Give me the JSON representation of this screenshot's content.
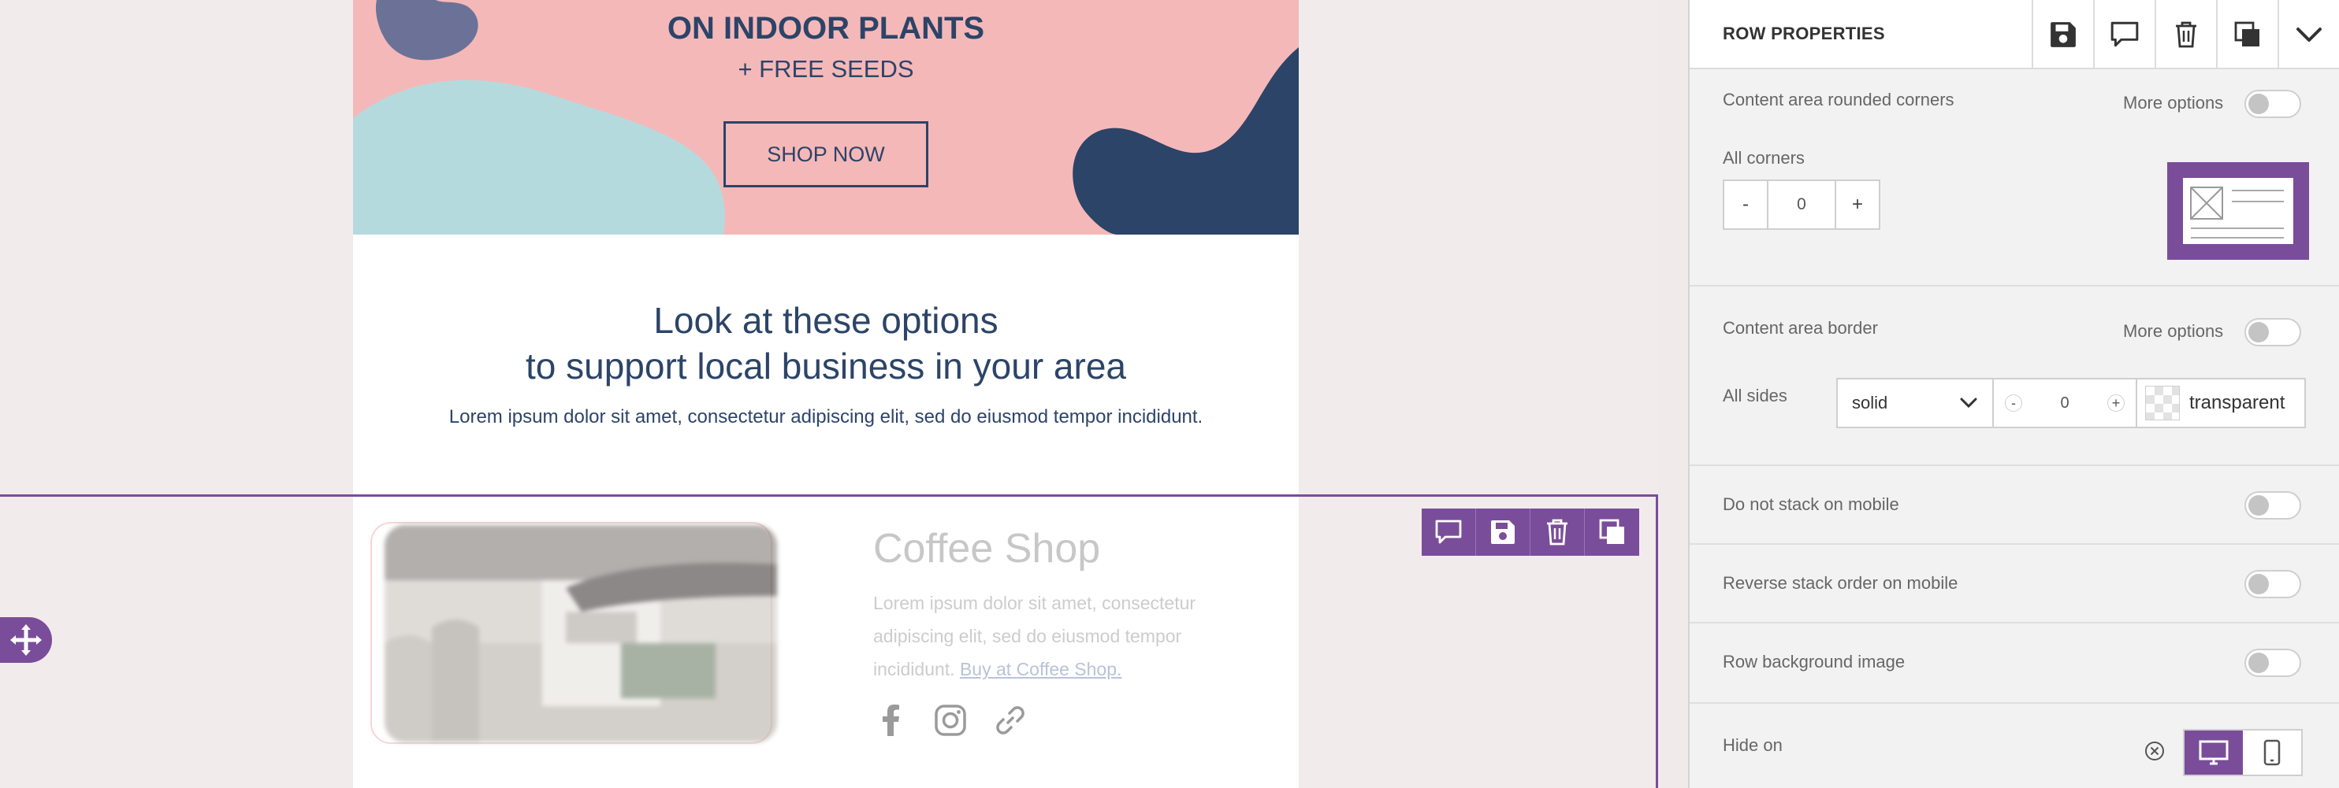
{
  "hero": {
    "title": "ON INDOOR PLANTS",
    "subtitle": "+ FREE SEEDS",
    "button": "SHOP NOW"
  },
  "section2": {
    "heading_line1": "Look at these options",
    "heading_line2": "to support local business in your area",
    "paragraph": "Lorem ipsum dolor sit amet, consectetur adipiscing elit, sed do eiusmod tempor incididunt."
  },
  "row": {
    "title": "Coffee Shop",
    "text": "Lorem ipsum dolor sit amet, consectetur adipiscing elit, sed do eiusmod tempor incididunt.",
    "link": "Buy at Coffee Shop.",
    "social_icons": [
      "facebook-icon",
      "instagram-icon",
      "link-icon"
    ],
    "toolbar_icons": [
      "comment-icon",
      "save-icon",
      "trash-icon",
      "duplicate-icon"
    ]
  },
  "panel": {
    "title": "ROW PROPERTIES",
    "header_icons": [
      "save-icon",
      "comment-icon",
      "trash-icon",
      "duplicate-icon",
      "chevron-down-icon"
    ],
    "rounded": {
      "label": "Content area rounded corners",
      "more": "More options",
      "all_label": "All corners",
      "minus": "-",
      "value": "0",
      "plus": "+"
    },
    "border": {
      "label": "Content area border",
      "more": "More options",
      "all_label": "All sides",
      "style": "solid",
      "minus": "-",
      "width": "0",
      "plus": "+",
      "color": "transparent"
    },
    "no_stack": {
      "label": "Do not stack on mobile"
    },
    "reverse": {
      "label": "Reverse stack order on mobile"
    },
    "bg_image": {
      "label": "Row background image"
    },
    "hide_on": {
      "label": "Hide on",
      "options": [
        "desktop-icon",
        "mobile-icon"
      ],
      "active": "desktop-icon"
    }
  },
  "colors": {
    "accent": "#7a4d9a",
    "navy": "#2c4468",
    "hero_pink": "#f5b8b8",
    "hero_teal": "#b5dade"
  }
}
